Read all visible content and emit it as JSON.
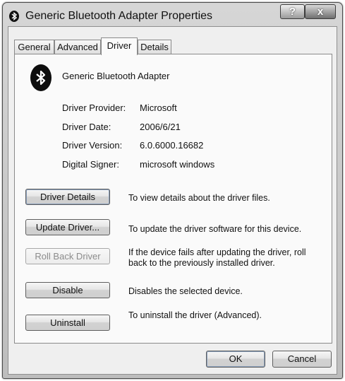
{
  "window": {
    "title": "Generic Bluetooth Adapter Properties",
    "help_glyph": "?",
    "close_glyph": "x"
  },
  "tabs": [
    {
      "label": "General",
      "active": false
    },
    {
      "label": "Advanced",
      "active": false
    },
    {
      "label": "Driver",
      "active": true
    },
    {
      "label": "Details",
      "active": false
    }
  ],
  "device": {
    "icon": "bluetooth-icon",
    "name": "Generic Bluetooth Adapter"
  },
  "properties": [
    {
      "label": "Driver Provider:",
      "value": "Microsoft"
    },
    {
      "label": "Driver Date:",
      "value": "2006/6/21"
    },
    {
      "label": "Driver Version:",
      "value": "6.0.6000.16682"
    },
    {
      "label": "Digital Signer:",
      "value": "microsoft windows"
    }
  ],
  "actions": [
    {
      "label": "Driver Details",
      "description": "To view details about the driver files.",
      "enabled": true
    },
    {
      "label": "Update Driver...",
      "description": "To update the driver software for this device.",
      "enabled": true
    },
    {
      "label": "Roll Back Driver",
      "description_line1": "If the device fails after updating the driver, roll",
      "description_line2": "back to the previously installed driver.",
      "enabled": false
    },
    {
      "label": "Disable",
      "description": "Disables the selected device.",
      "enabled": true
    },
    {
      "label": "Uninstall",
      "description": "To uninstall the driver (Advanced).",
      "enabled": true
    }
  ],
  "footer": {
    "ok_label": "OK",
    "cancel_label": "Cancel"
  }
}
